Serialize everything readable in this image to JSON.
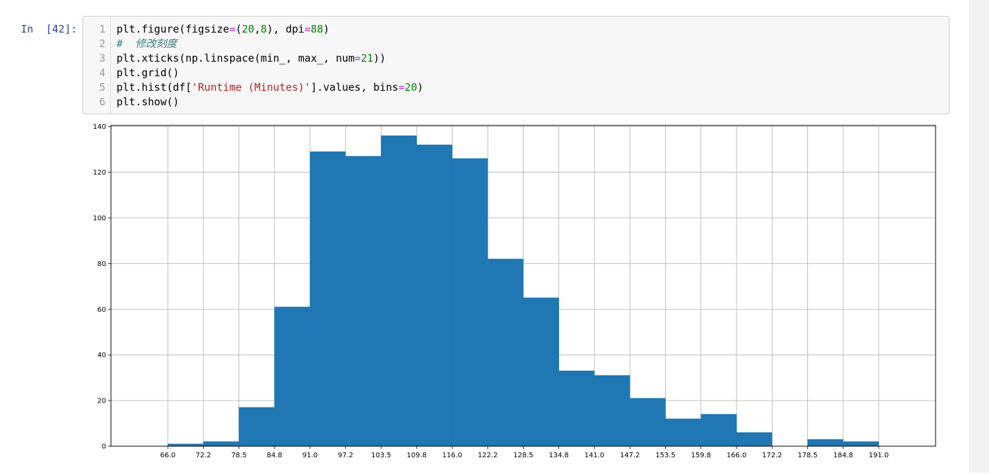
{
  "prompt": "In  [42]:",
  "code_lines": [
    {
      "num": "1",
      "tokens": [
        {
          "t": "plt.figure(figsize",
          "c": ""
        },
        {
          "t": "=",
          "c": "op"
        },
        {
          "t": "(",
          "c": ""
        },
        {
          "t": "20",
          "c": "num"
        },
        {
          "t": ",",
          "c": ""
        },
        {
          "t": "8",
          "c": "num"
        },
        {
          "t": "), dpi",
          "c": ""
        },
        {
          "t": "=",
          "c": "op"
        },
        {
          "t": "88",
          "c": "num"
        },
        {
          "t": ")",
          "c": ""
        }
      ]
    },
    {
      "num": "2",
      "tokens": [
        {
          "t": "#  修改刻度",
          "c": "cm"
        }
      ]
    },
    {
      "num": "3",
      "tokens": [
        {
          "t": "plt.xticks(np.linspace(min_, max_, num",
          "c": ""
        },
        {
          "t": "=",
          "c": "op"
        },
        {
          "t": "21",
          "c": "num"
        },
        {
          "t": "))",
          "c": ""
        }
      ]
    },
    {
      "num": "4",
      "tokens": [
        {
          "t": "plt.grid()",
          "c": ""
        }
      ]
    },
    {
      "num": "5",
      "tokens": [
        {
          "t": "plt.hist(df[",
          "c": ""
        },
        {
          "t": "'Runtime (Minutes)'",
          "c": "str"
        },
        {
          "t": "].values, bins",
          "c": ""
        },
        {
          "t": "=",
          "c": "op"
        },
        {
          "t": "20",
          "c": "num"
        },
        {
          "t": ")",
          "c": ""
        }
      ]
    },
    {
      "num": "6",
      "tokens": [
        {
          "t": "plt.show()",
          "c": ""
        }
      ]
    }
  ],
  "chart_data": {
    "type": "bar",
    "subtype": "histogram",
    "title": "",
    "xlabel": "",
    "ylabel": "",
    "bin_start": 66.0,
    "bin_width": 6.25,
    "xlim": [
      56.0,
      201.0
    ],
    "ylim": [
      0,
      140.5
    ],
    "x_ticks": [
      "66.0",
      "72.2",
      "78.5",
      "84.8",
      "91.0",
      "97.2",
      "103.5",
      "109.8",
      "116.0",
      "122.2",
      "128.5",
      "134.8",
      "141.0",
      "147.2",
      "153.5",
      "159.8",
      "166.0",
      "172.2",
      "178.5",
      "184.8",
      "191.0"
    ],
    "y_ticks": [
      "0",
      "20",
      "40",
      "60",
      "80",
      "100",
      "120",
      "140"
    ],
    "values": [
      1,
      2,
      17,
      61,
      129,
      127,
      136,
      132,
      126,
      82,
      65,
      33,
      31,
      21,
      12,
      14,
      6,
      0,
      3,
      2
    ],
    "grid": true,
    "bar_color": "#1f77b4",
    "edge_color": "#1f77b4"
  }
}
